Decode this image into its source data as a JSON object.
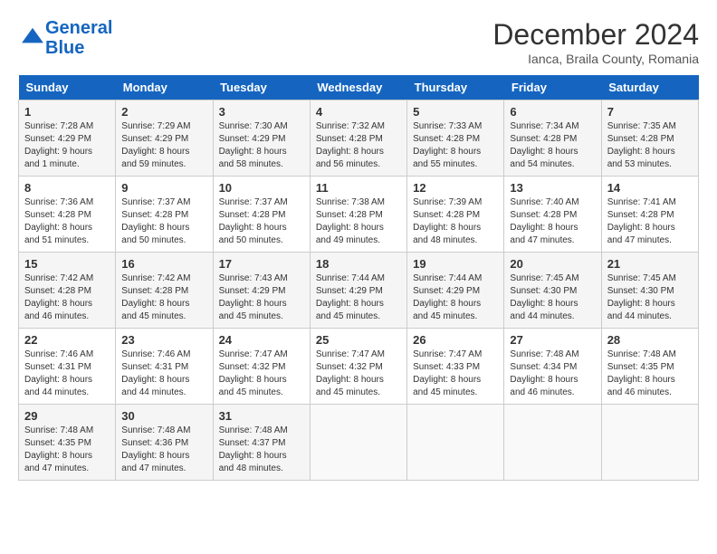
{
  "header": {
    "logo_line1": "General",
    "logo_line2": "Blue",
    "month": "December 2024",
    "location": "Ianca, Braila County, Romania"
  },
  "weekdays": [
    "Sunday",
    "Monday",
    "Tuesday",
    "Wednesday",
    "Thursday",
    "Friday",
    "Saturday"
  ],
  "weeks": [
    [
      {
        "day": "1",
        "sunrise": "Sunrise: 7:28 AM",
        "sunset": "Sunset: 4:29 PM",
        "daylight": "Daylight: 9 hours and 1 minute."
      },
      {
        "day": "2",
        "sunrise": "Sunrise: 7:29 AM",
        "sunset": "Sunset: 4:29 PM",
        "daylight": "Daylight: 8 hours and 59 minutes."
      },
      {
        "day": "3",
        "sunrise": "Sunrise: 7:30 AM",
        "sunset": "Sunset: 4:29 PM",
        "daylight": "Daylight: 8 hours and 58 minutes."
      },
      {
        "day": "4",
        "sunrise": "Sunrise: 7:32 AM",
        "sunset": "Sunset: 4:28 PM",
        "daylight": "Daylight: 8 hours and 56 minutes."
      },
      {
        "day": "5",
        "sunrise": "Sunrise: 7:33 AM",
        "sunset": "Sunset: 4:28 PM",
        "daylight": "Daylight: 8 hours and 55 minutes."
      },
      {
        "day": "6",
        "sunrise": "Sunrise: 7:34 AM",
        "sunset": "Sunset: 4:28 PM",
        "daylight": "Daylight: 8 hours and 54 minutes."
      },
      {
        "day": "7",
        "sunrise": "Sunrise: 7:35 AM",
        "sunset": "Sunset: 4:28 PM",
        "daylight": "Daylight: 8 hours and 53 minutes."
      }
    ],
    [
      {
        "day": "8",
        "sunrise": "Sunrise: 7:36 AM",
        "sunset": "Sunset: 4:28 PM",
        "daylight": "Daylight: 8 hours and 51 minutes."
      },
      {
        "day": "9",
        "sunrise": "Sunrise: 7:37 AM",
        "sunset": "Sunset: 4:28 PM",
        "daylight": "Daylight: 8 hours and 50 minutes."
      },
      {
        "day": "10",
        "sunrise": "Sunrise: 7:37 AM",
        "sunset": "Sunset: 4:28 PM",
        "daylight": "Daylight: 8 hours and 50 minutes."
      },
      {
        "day": "11",
        "sunrise": "Sunrise: 7:38 AM",
        "sunset": "Sunset: 4:28 PM",
        "daylight": "Daylight: 8 hours and 49 minutes."
      },
      {
        "day": "12",
        "sunrise": "Sunrise: 7:39 AM",
        "sunset": "Sunset: 4:28 PM",
        "daylight": "Daylight: 8 hours and 48 minutes."
      },
      {
        "day": "13",
        "sunrise": "Sunrise: 7:40 AM",
        "sunset": "Sunset: 4:28 PM",
        "daylight": "Daylight: 8 hours and 47 minutes."
      },
      {
        "day": "14",
        "sunrise": "Sunrise: 7:41 AM",
        "sunset": "Sunset: 4:28 PM",
        "daylight": "Daylight: 8 hours and 47 minutes."
      }
    ],
    [
      {
        "day": "15",
        "sunrise": "Sunrise: 7:42 AM",
        "sunset": "Sunset: 4:28 PM",
        "daylight": "Daylight: 8 hours and 46 minutes."
      },
      {
        "day": "16",
        "sunrise": "Sunrise: 7:42 AM",
        "sunset": "Sunset: 4:28 PM",
        "daylight": "Daylight: 8 hours and 45 minutes."
      },
      {
        "day": "17",
        "sunrise": "Sunrise: 7:43 AM",
        "sunset": "Sunset: 4:29 PM",
        "daylight": "Daylight: 8 hours and 45 minutes."
      },
      {
        "day": "18",
        "sunrise": "Sunrise: 7:44 AM",
        "sunset": "Sunset: 4:29 PM",
        "daylight": "Daylight: 8 hours and 45 minutes."
      },
      {
        "day": "19",
        "sunrise": "Sunrise: 7:44 AM",
        "sunset": "Sunset: 4:29 PM",
        "daylight": "Daylight: 8 hours and 45 minutes."
      },
      {
        "day": "20",
        "sunrise": "Sunrise: 7:45 AM",
        "sunset": "Sunset: 4:30 PM",
        "daylight": "Daylight: 8 hours and 44 minutes."
      },
      {
        "day": "21",
        "sunrise": "Sunrise: 7:45 AM",
        "sunset": "Sunset: 4:30 PM",
        "daylight": "Daylight: 8 hours and 44 minutes."
      }
    ],
    [
      {
        "day": "22",
        "sunrise": "Sunrise: 7:46 AM",
        "sunset": "Sunset: 4:31 PM",
        "daylight": "Daylight: 8 hours and 44 minutes."
      },
      {
        "day": "23",
        "sunrise": "Sunrise: 7:46 AM",
        "sunset": "Sunset: 4:31 PM",
        "daylight": "Daylight: 8 hours and 44 minutes."
      },
      {
        "day": "24",
        "sunrise": "Sunrise: 7:47 AM",
        "sunset": "Sunset: 4:32 PM",
        "daylight": "Daylight: 8 hours and 45 minutes."
      },
      {
        "day": "25",
        "sunrise": "Sunrise: 7:47 AM",
        "sunset": "Sunset: 4:32 PM",
        "daylight": "Daylight: 8 hours and 45 minutes."
      },
      {
        "day": "26",
        "sunrise": "Sunrise: 7:47 AM",
        "sunset": "Sunset: 4:33 PM",
        "daylight": "Daylight: 8 hours and 45 minutes."
      },
      {
        "day": "27",
        "sunrise": "Sunrise: 7:48 AM",
        "sunset": "Sunset: 4:34 PM",
        "daylight": "Daylight: 8 hours and 46 minutes."
      },
      {
        "day": "28",
        "sunrise": "Sunrise: 7:48 AM",
        "sunset": "Sunset: 4:35 PM",
        "daylight": "Daylight: 8 hours and 46 minutes."
      }
    ],
    [
      {
        "day": "29",
        "sunrise": "Sunrise: 7:48 AM",
        "sunset": "Sunset: 4:35 PM",
        "daylight": "Daylight: 8 hours and 47 minutes."
      },
      {
        "day": "30",
        "sunrise": "Sunrise: 7:48 AM",
        "sunset": "Sunset: 4:36 PM",
        "daylight": "Daylight: 8 hours and 47 minutes."
      },
      {
        "day": "31",
        "sunrise": "Sunrise: 7:48 AM",
        "sunset": "Sunset: 4:37 PM",
        "daylight": "Daylight: 8 hours and 48 minutes."
      },
      null,
      null,
      null,
      null
    ]
  ]
}
